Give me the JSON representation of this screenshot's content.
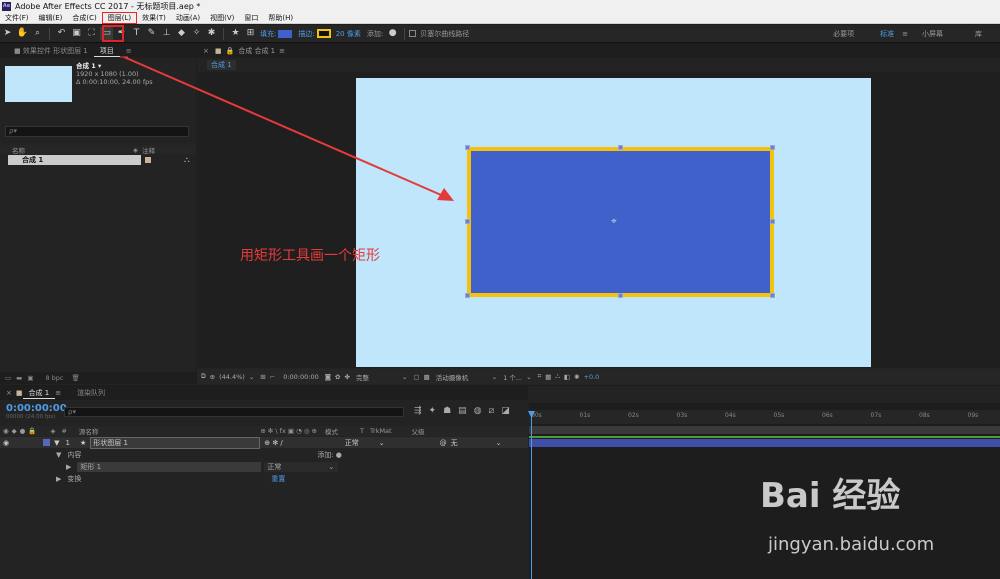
{
  "window": {
    "logo": "Ae",
    "title": "Adobe After Effects CC 2017 - 无标题项目.aep *"
  },
  "menu": [
    "文件(F)",
    "编辑(E)",
    "合成(C)",
    "图层(L)",
    "效果(T)",
    "动画(A)",
    "视图(V)",
    "窗口",
    "帮助(H)"
  ],
  "toolbar": {
    "fill_label": "填充:",
    "stroke_label": "描边:",
    "stroke_px": "20 像素",
    "add_label": "添加:",
    "bezier_label": "贝塞尔曲线路径",
    "workspaces": [
      "必要项",
      "标准",
      "小屏幕",
      "库"
    ],
    "active_workspace": "标准",
    "fill_color": "#3f61c9",
    "stroke_color": "#f4c20d"
  },
  "project": {
    "tabs": [
      "效果控件 形状图层 1",
      "项目"
    ],
    "comp_name": "合成 1 ▾",
    "comp_size": "1920 x 1080 (1.00)",
    "comp_duration": "Δ 0:00:10:00, 24.00 fps",
    "search_placeholder": "ρ▾",
    "col_name": "名称",
    "col_comment": "注释",
    "item": "合成 1",
    "bpc": "8 bpc"
  },
  "viewer": {
    "tab_label": "合成 合成 1",
    "breadcrumb": "合成 1",
    "zoom": "(44.4%)",
    "timecode": "0:00:00:00",
    "quality": "完整",
    "camera": "活动摄像机",
    "views": "1 个...",
    "exposure": "+0.0",
    "canvas_color": "#bfe6fb"
  },
  "annotation": "用矩形工具画一个矩形",
  "timeline": {
    "tabs": [
      "合成 1",
      "渲染队列"
    ],
    "timecode": "0:00:00:00",
    "fps": "00000 (24.00 fps)",
    "search_placeholder": "ρ▾",
    "col_source": "源名称",
    "col_mode": "模式",
    "col_trkmat": "TrkMat",
    "col_parent": "父级",
    "layer_num": "1",
    "layer_name": "形状图层 1",
    "layer_mode": "正常",
    "layer_parent": "无",
    "content_label": "内容",
    "add_label": "添加:",
    "rect_name": "矩形 1",
    "rect_mode": "正常",
    "transform_label": "变换",
    "reset_label": "重置",
    "ruler": [
      "00s",
      "01s",
      "02s",
      "03s",
      "04s",
      "05s",
      "06s",
      "07s",
      "08s",
      "09s"
    ]
  },
  "watermark": {
    "brand": "Bai 经验",
    "url": "jingyan.baidu.com"
  }
}
